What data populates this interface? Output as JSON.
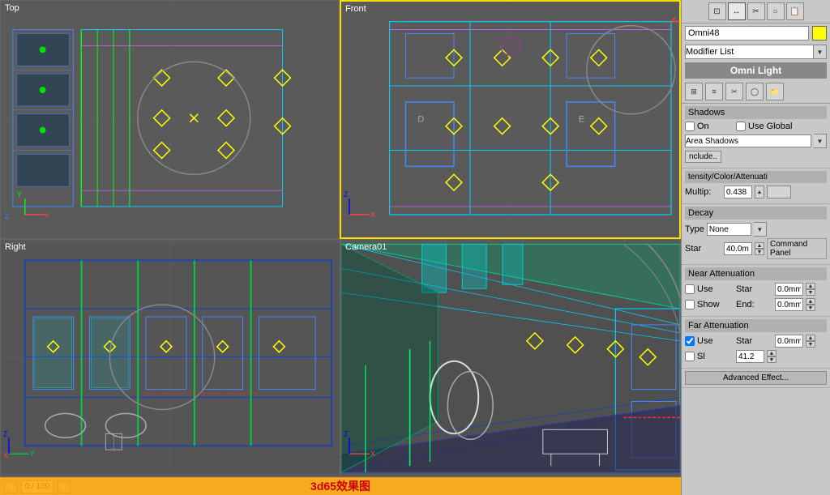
{
  "viewports": {
    "top": {
      "label": "Top"
    },
    "front": {
      "label": "Front"
    },
    "right": {
      "label": "Right"
    },
    "camera": {
      "label": "Camera01"
    }
  },
  "right_panel": {
    "name_field": "Omni48",
    "modifier_list_label": "Modifier List",
    "omni_light_label": "Omni Light",
    "command_panel_label": "Command Panel",
    "shadows": {
      "header": "Shadows",
      "on_label": "On",
      "use_global_label": "Use Global",
      "type_label": "Area Shadows",
      "include_btn": "nclude.."
    },
    "intensity": {
      "header": "tensity/Color/Attenuati",
      "multip_label": "Multip:",
      "multip_value": "0.438",
      "color_swatch": ""
    },
    "decay": {
      "header": "Decay",
      "type_label": "Type",
      "type_value": "None",
      "start_label": "Star",
      "start_value": "40.0m"
    },
    "near_attenuation": {
      "header": "Near Attenuation",
      "use_label": "Use",
      "start_label": "Star",
      "start_value": "0.0mm",
      "show_label": "Show",
      "end_label": "End:",
      "end_value": "0.0mm"
    },
    "far_attenuation": {
      "header": "Far Attenuation",
      "use_label": "Use",
      "start_label": "Star",
      "start_value": "0.0mm",
      "sl_label": "Sl",
      "end_value": "41.2"
    }
  },
  "bottom_bar": {
    "frame_value": "0 / 100"
  },
  "watermark": {
    "text": "3d65效果图"
  },
  "toolbar_icons": {
    "icon1": "⊡",
    "icon2": "↔",
    "icon3": "✂",
    "icon4": "○",
    "icon5": "📋"
  }
}
